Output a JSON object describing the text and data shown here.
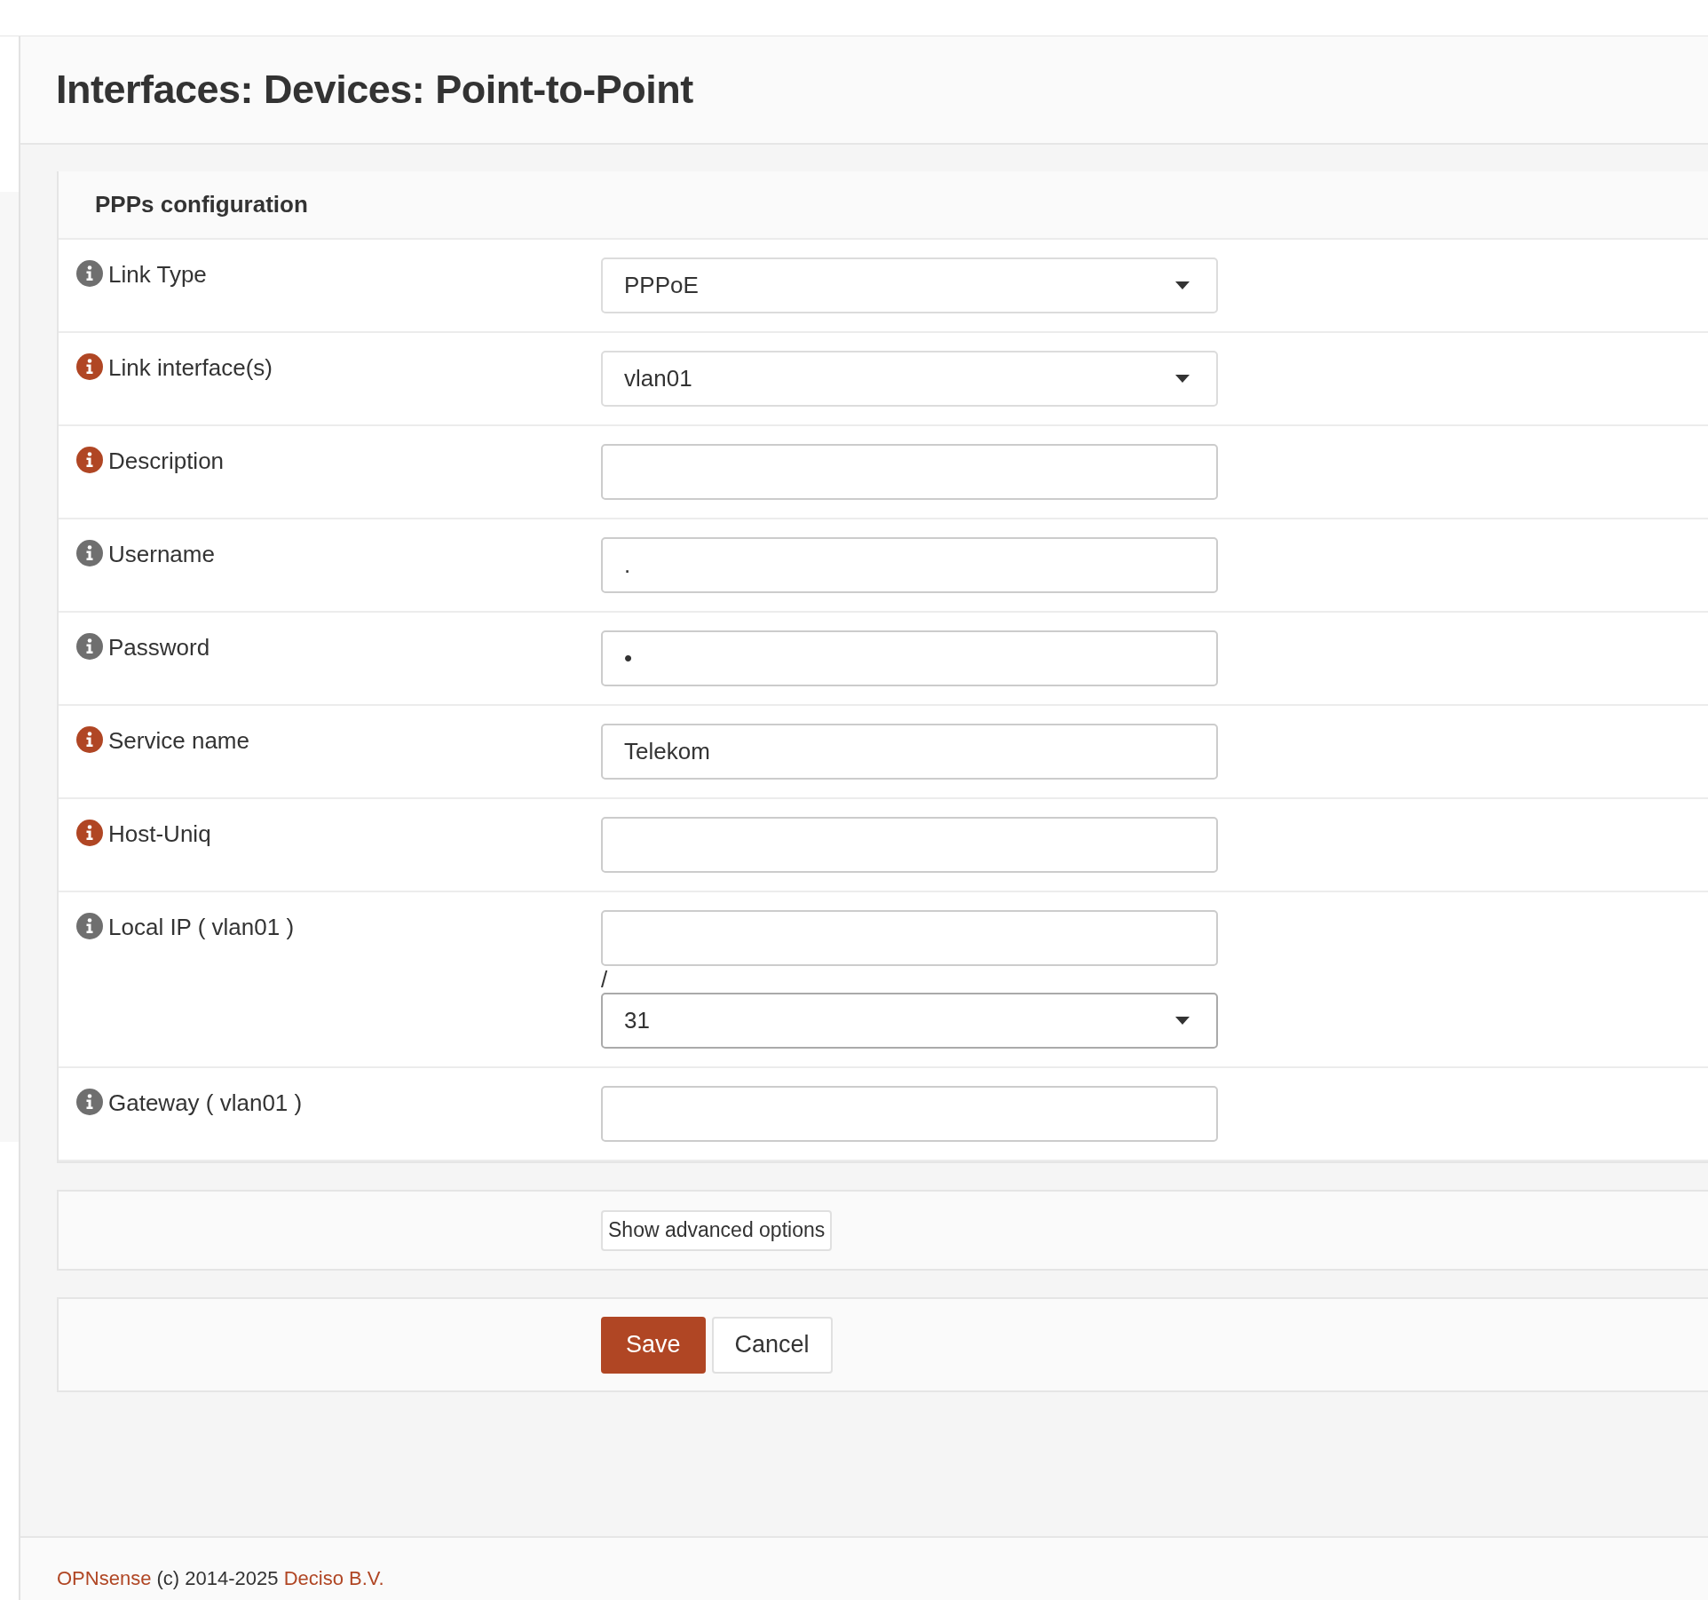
{
  "page_title": "Interfaces: Devices: Point-to-Point",
  "panel": {
    "title": "PPPs configuration",
    "fields": [
      {
        "kind": "select",
        "label": "Link Type",
        "value": "PPPoE",
        "color": "#6f6f6f"
      },
      {
        "kind": "select",
        "label": "Link interface(s)",
        "value": "vlan01",
        "color": "#b04624"
      },
      {
        "kind": "text",
        "label": "Description",
        "color": "#b04624"
      },
      {
        "kind": "text",
        "label": "Username",
        "value": ".",
        "color": "#6f6f6f"
      },
      {
        "kind": "text",
        "label": "Password",
        "value": "•",
        "color": "#6f6f6f"
      },
      {
        "kind": "text",
        "label": "Service name",
        "value": "Telekom",
        "color": "#b04624"
      },
      {
        "kind": "text",
        "label": "Host-Uniq",
        "color": "#b04624"
      },
      {
        "kind": "ip_mask",
        "label": "Local IP ( vlan01 )",
        "separator": "/",
        "mask": "31",
        "color": "#6f6f6f"
      },
      {
        "kind": "text",
        "label": "Gateway ( vlan01 )",
        "color": "#6f6f6f"
      }
    ]
  },
  "advanced_button": "Show advanced options",
  "buttons": [
    {
      "kind": "primary",
      "label": "Save"
    },
    {
      "kind": "default",
      "label": "Cancel"
    }
  ],
  "footer": [
    {
      "kind": "link",
      "text": "OPNsense"
    },
    {
      "kind": "text",
      "text": "(c) 2014-2025"
    },
    {
      "kind": "link",
      "text": "Deciso B.V."
    }
  ]
}
